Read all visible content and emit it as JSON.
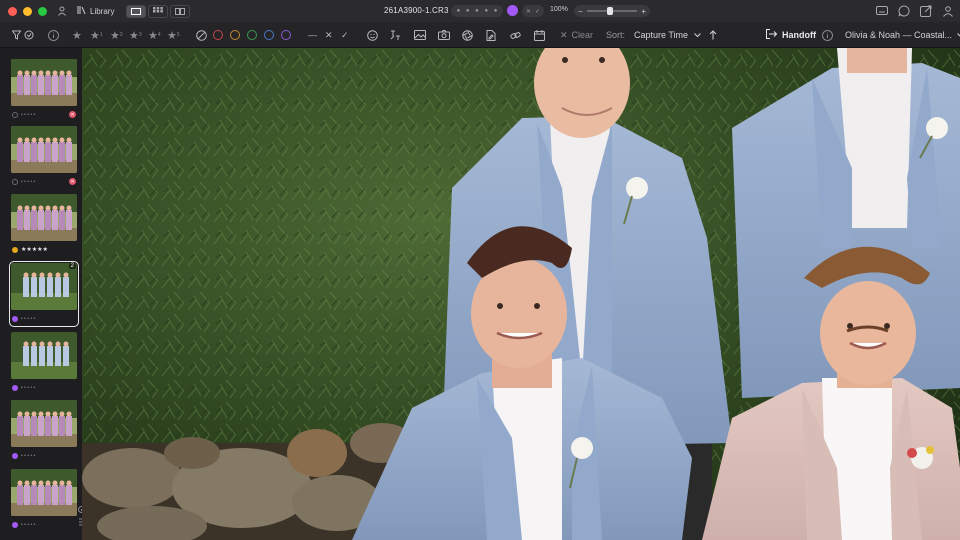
{
  "titlebar": {
    "library_label": "Library",
    "filename": "261A3900-1.CR3",
    "zoom_level": "100%",
    "zoom_minus": "−",
    "zoom_plus": "+"
  },
  "toolbar": {
    "clear_label": "Clear",
    "sort_label": "Sort:",
    "sort_value": "Capture Time",
    "handoff_label": "Handoff",
    "session_name": "Olivia & Noah — Coastal..."
  },
  "ratings": [
    "1",
    "2",
    "3",
    "4",
    "5"
  ],
  "colors": {
    "accent_purple": "#a259f5",
    "reject_red": "#e0566a",
    "label_yellow": "#e3a61a",
    "label_red": "#c2454a",
    "label_orange": "#c98a2c",
    "label_green": "#3d9a4b",
    "label_blue": "#4a78c8",
    "label_purple": "#8a5ad0"
  },
  "filmstrip": {
    "thumbs": [
      {
        "stars": "• • • • •",
        "status": "rejected"
      },
      {
        "stars": "• • • • •",
        "status": "rejected"
      },
      {
        "stars": "★★★★★",
        "status": "yellow"
      },
      {
        "stars": "• • • • •",
        "status": "purple",
        "stack_count": "2",
        "selected": true
      },
      {
        "stars": "• • • • •",
        "status": "purple"
      },
      {
        "stars": "• • • • •",
        "status": "purple"
      },
      {
        "stars": "• • • • •",
        "status": "purple"
      }
    ],
    "info_icon": "info-icon"
  }
}
